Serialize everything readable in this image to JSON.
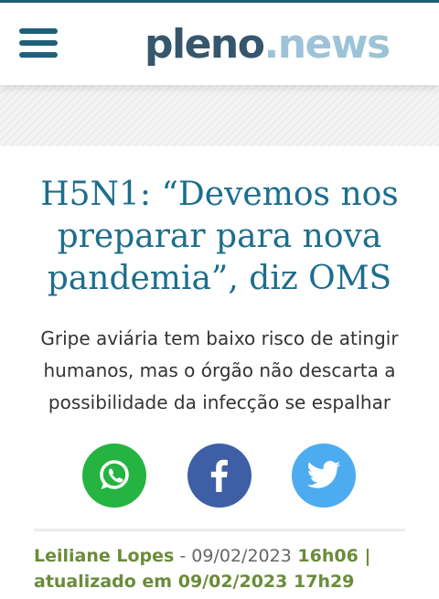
{
  "header": {
    "menu_icon": "hamburger-menu-icon",
    "logo": {
      "brand": "plen",
      "mark": "o",
      "dot": ".",
      "suffix": "news"
    },
    "colors": {
      "accent": "#1f5f78",
      "logo_primary": "#35566d",
      "logo_secondary": "#9cc3d8"
    }
  },
  "article": {
    "title": "H5N1: “Devemos nos preparar para nova pandemia”, diz OMS",
    "subtitle": "Gripe aviária tem baixo risco de atingir humanos, mas o órgão não descarta a possibilidade da infecção se espalhar",
    "title_color": "#1d6e8c",
    "share": [
      {
        "network": "whatsapp",
        "icon": "whatsapp-icon",
        "color": "#25b341"
      },
      {
        "network": "facebook",
        "icon": "facebook-icon",
        "color": "#3e5fa5"
      },
      {
        "network": "twitter",
        "icon": "twitter-icon",
        "color": "#4dacef"
      }
    ],
    "byline": {
      "author": "Leiliane Lopes",
      "separator": " - ",
      "published_date": "09/02/2023",
      "published_time": "16h06",
      "updated_prefix": " | atualizado em ",
      "updated_date": "09/02/2023",
      "updated_time": "17h29",
      "author_color": "#6a8c3a"
    }
  }
}
